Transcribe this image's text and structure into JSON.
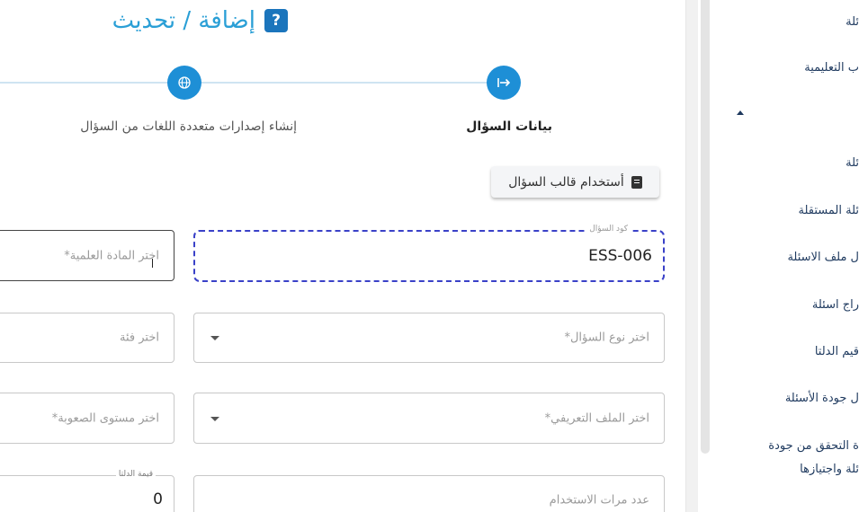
{
  "page": {
    "title": "إضافة / تحديث",
    "title_icon": "question-icon"
  },
  "stepper": {
    "steps": [
      {
        "label": "بيانات السؤال",
        "icon": "arrow-in-icon",
        "active": true
      },
      {
        "label": "إنشاء إصدارات متعددة اللغات من السؤال",
        "icon": "globe-icon",
        "active": false
      }
    ]
  },
  "form": {
    "template_button": "أستخدام قالب السؤال",
    "question_code": {
      "label": "كود السؤال",
      "value": "ESS-006"
    },
    "subject": {
      "placeholder": "اختر المادة العلمية*"
    },
    "question_type": {
      "placeholder": "اختر نوع السؤال*"
    },
    "category": {
      "placeholder": "اختر فئة"
    },
    "profile": {
      "placeholder": "اختر الملف التعريفي*"
    },
    "difficulty": {
      "placeholder": "اختر مستوى الصعوبة*"
    },
    "usage_count": {
      "placeholder": "عدد مرات الاستخدام"
    },
    "delta": {
      "label": "قيمة الدلتا",
      "value": "0"
    }
  },
  "sidebar": {
    "items": [
      "ئلة",
      "ب التعليمية",
      "ئلة",
      "ئلة المستقلة",
      "ل ملف الاسئلة",
      "راج اسئلة",
      "قيم الدلتا",
      "ل جودة الأسئلة",
      "ة التحقق من جودة",
      "ئلة واجتيازها"
    ]
  },
  "colors": {
    "accent": "#1e8fd6",
    "title": "#2a9fd6",
    "focus_border": "#3a41c8",
    "sidebar_text": "#1f3a5f"
  }
}
